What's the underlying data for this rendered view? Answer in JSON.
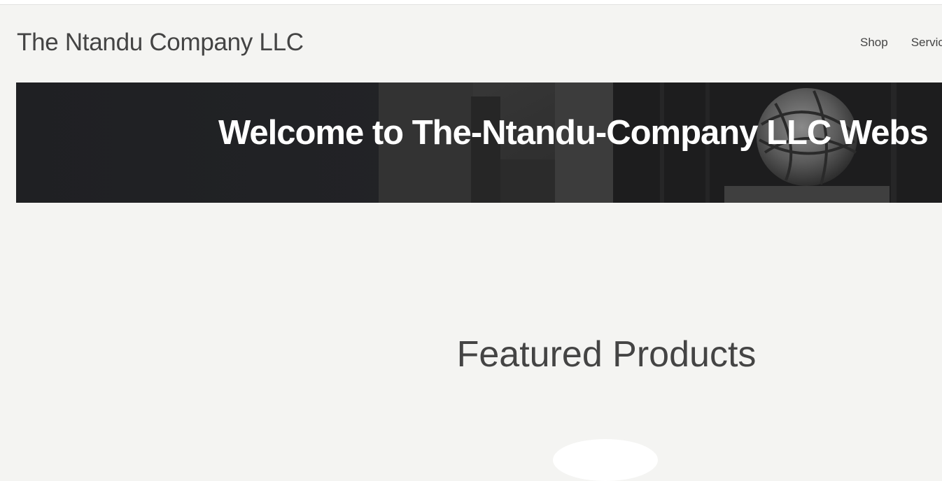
{
  "site": {
    "title": "The Ntandu Company LLC"
  },
  "nav": {
    "items": [
      {
        "label": "Shop"
      },
      {
        "label": "Servic"
      }
    ]
  },
  "hero": {
    "title": "Welcome to  The-Ntandu-Company LLC Webs"
  },
  "featured": {
    "heading": "Featured Products"
  },
  "colors": {
    "background": "#f4f4f2",
    "text": "#444444",
    "hero_background": "#202124",
    "hero_text": "#ffffff"
  }
}
